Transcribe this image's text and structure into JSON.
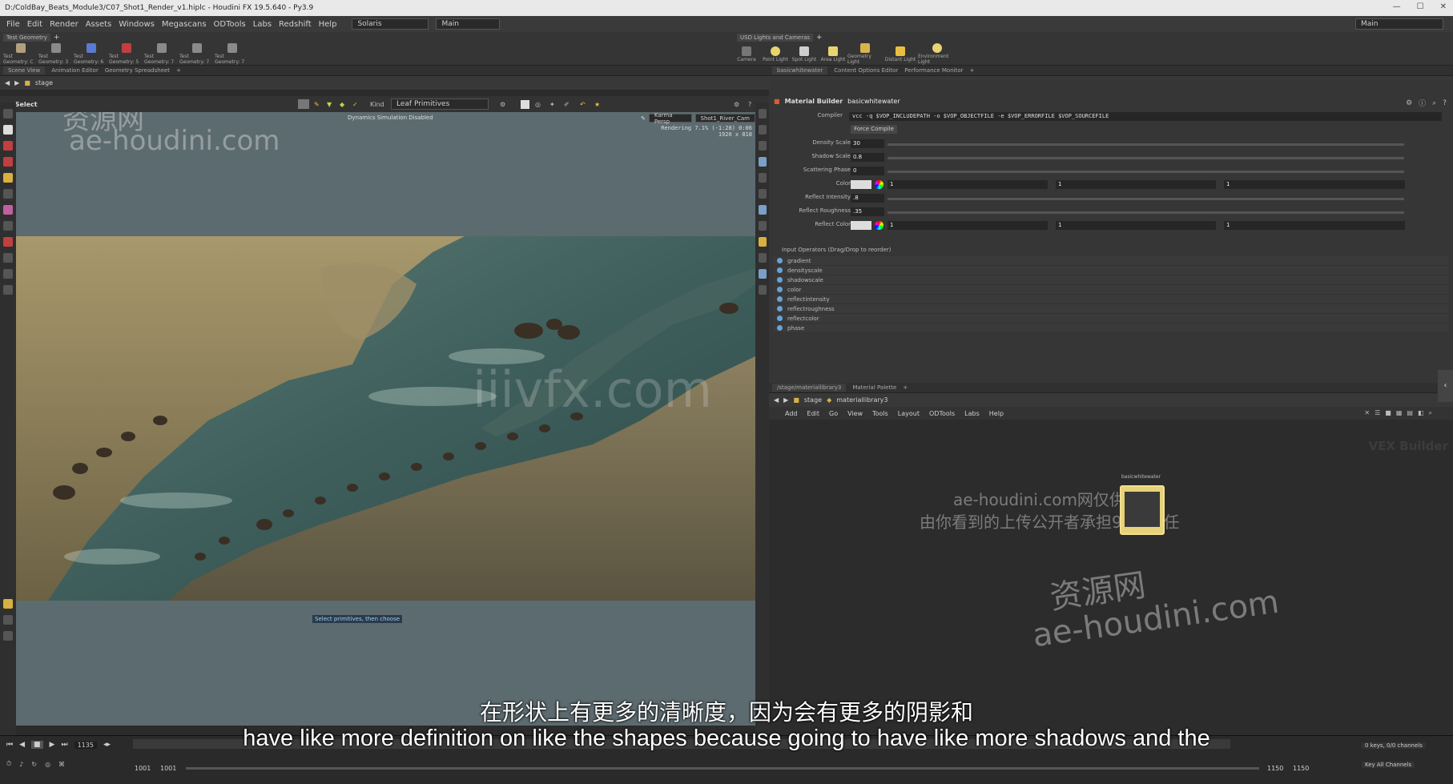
{
  "window": {
    "title": "D:/ColdBay_Beats_Module3/C07_Shot1_Render_v1.hiplc - Houdini FX 19.5.640 - Py3.9"
  },
  "menubar": {
    "items": [
      "File",
      "Edit",
      "Render",
      "Assets",
      "Windows",
      "Megascans",
      "ODTools",
      "Labs",
      "Redshift",
      "Help"
    ],
    "desktop": "Solaris",
    "network": "Main",
    "right_desktop": "Main"
  },
  "shelf": {
    "left_tab": "Test Geometry",
    "left_tools": [
      "Test Geometry: C",
      "Test Geometry: 3",
      "Test Geometry: 6",
      "Test Geometry: 5",
      "Test Geometry: 7",
      "Test Geometry: 7",
      "Test Geometry: 7"
    ],
    "right_tab": "USD Lights and Cameras",
    "right_tools": [
      "Camera",
      "Point Light",
      "Spot Light",
      "Area Light",
      "Geometry Light",
      "Distant Light",
      "Environment Light"
    ]
  },
  "left_pane_tabs": [
    "Scene View",
    "Animation Editor",
    "Geometry Spreadsheet"
  ],
  "left_path": "stage",
  "viewport": {
    "tool": "Select",
    "kind_label": "Kind",
    "selection_mode": "Leaf Primitives",
    "status": "Dynamics Simulation Disabled",
    "renderer": "Karma Persp",
    "camera": "Shot1_River_Cam",
    "render_info": "Rendering  7.1%  (-1:28)  0:06",
    "resolution": "1920 x 818",
    "hint": "Select primitives, then choose"
  },
  "right_pane_tabs": [
    "basicwhitewater",
    "Content Options Editor",
    "Performance Monitor"
  ],
  "right_path": {
    "root": "stage",
    "node": "materiallibrary3"
  },
  "params": {
    "builder_label": "Material Builder",
    "builder_name": "basicwhitewater",
    "compiler_label": "Compiler",
    "compiler_value": "vcc -q $VOP_INCLUDEPATH -o $VOP_OBJECTFILE -e $VOP_ERRORFILE $VOP_SOURCEFILE",
    "force_compile": "Force Compile",
    "rows": [
      {
        "label": "Density Scale",
        "value": "30"
      },
      {
        "label": "Shadow Scale",
        "value": "0.8"
      },
      {
        "label": "Scattering Phase",
        "value": "0"
      },
      {
        "label": "Color",
        "value": "1",
        "v2": "1",
        "v3": "1"
      },
      {
        "label": "Reflect Intensity",
        "value": ".8"
      },
      {
        "label": "Reflect Roughness",
        "value": ".35"
      },
      {
        "label": "Reflect Color",
        "value": "1",
        "v2": "1",
        "v3": "1"
      }
    ],
    "operators_label": "Input Operators (Drag/Drop to reorder)",
    "operators": [
      "gradient",
      "densityscale",
      "shadowscale",
      "color",
      "reflectintensity",
      "reflectroughness",
      "reflectcolor",
      "phase"
    ]
  },
  "network": {
    "tabs": [
      "/stage/materiallibrary3",
      "Material Palette"
    ],
    "path_root": "stage",
    "path_node": "materiallibrary3",
    "menu": [
      "Add",
      "Edit",
      "Go",
      "View",
      "Tools",
      "Layout",
      "ODTools",
      "Labs",
      "Help"
    ],
    "context_label": "VEX Builder",
    "node_name": "basicwhitewater"
  },
  "timeline": {
    "frame": "1135",
    "start": "1001",
    "start2": "1001",
    "end": "1150",
    "end2": "1150",
    "keys_info": "0 keys, 0/0 channels",
    "key_all": "Key All Channels"
  },
  "watermarks": {
    "top_left_cn": "资源网",
    "top_left_url": "ae-houdini.com",
    "center": "iiivfx.com",
    "right_line1": "ae-houdini.com网仅供研究",
    "right_line2": "由你看到的上传公开者承担99%责任",
    "bottom_right_cn": "资源网",
    "bottom_right_url": "ae-houdini.com"
  },
  "subtitles": {
    "cn": "在形状上有更多的清晰度，因为会有更多的阴影和",
    "en": "have like more definition on like the shapes because going to have like more shadows and the"
  }
}
